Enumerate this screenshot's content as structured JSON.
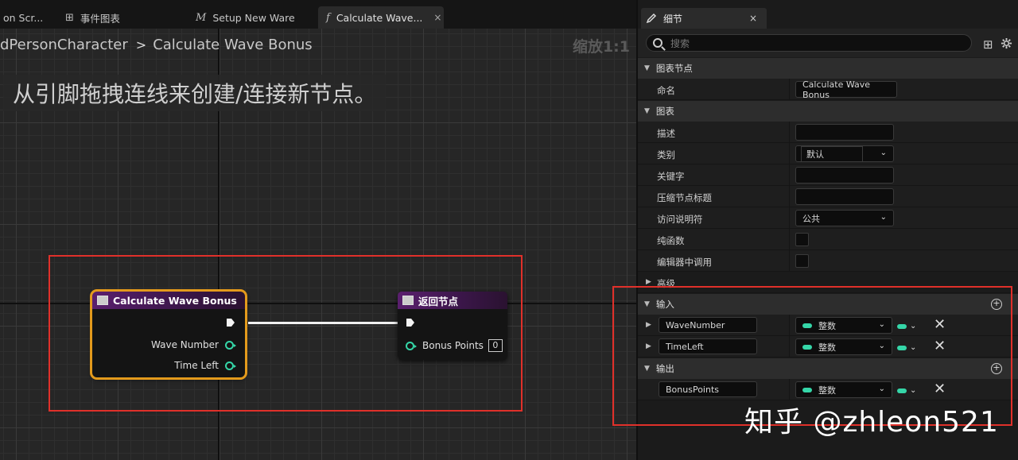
{
  "tabs": [
    {
      "label": "on Scr...",
      "icon": ""
    },
    {
      "label": "事件图表",
      "icon": "event-graph-icon"
    },
    {
      "label": "Setup New Ware",
      "icon": "macro-icon"
    },
    {
      "label": "Calculate Wave...",
      "icon": "function-icon",
      "active": true
    }
  ],
  "tab_icons": {
    "macro": "M",
    "function": "f",
    "close": "×",
    "grid": "⊞"
  },
  "graph": {
    "breadcrumb_parent": "dPersonCharacter",
    "breadcrumb_sep": ">",
    "breadcrumb_current": "Calculate Wave Bonus",
    "zoom": "缩放1:1",
    "hint": "从引脚拖拽连线来创建/连接新节点。"
  },
  "nodes": {
    "entry": {
      "title": "Calculate Wave Bonus",
      "pins": [
        "Wave Number",
        "Time Left"
      ]
    },
    "return": {
      "title": "返回节点",
      "pin": "Bonus Points",
      "pin_value": "0"
    }
  },
  "details": {
    "tab_label": "细节",
    "search_placeholder": "搜索",
    "sections": {
      "graph_node": "图表节点",
      "graph": "图表",
      "advanced": "高级",
      "inputs": "输入",
      "outputs": "输出"
    },
    "fields": {
      "name_label": "命名",
      "name_value": "Calculate Wave Bonus",
      "desc_label": "描述",
      "category_label": "类别",
      "category_value": "默认",
      "keywords_label": "关键字",
      "compact_label": "压缩节点标题",
      "access_label": "访问说明符",
      "access_value": "公共",
      "pure_label": "纯函数",
      "editor_label": "编辑器中调用"
    },
    "inputs": [
      {
        "name": "WaveNumber",
        "type": "整数"
      },
      {
        "name": "TimeLeft",
        "type": "整数"
      }
    ],
    "outputs": [
      {
        "name": "BonusPoints",
        "type": "整数"
      }
    ]
  },
  "watermark": "知乎 @zhleon521",
  "colors": {
    "accent_selection": "#e39a1c",
    "integer_pin": "#35d6a8",
    "highlight": "#e0302a",
    "function_header": "#5a1f6e"
  }
}
